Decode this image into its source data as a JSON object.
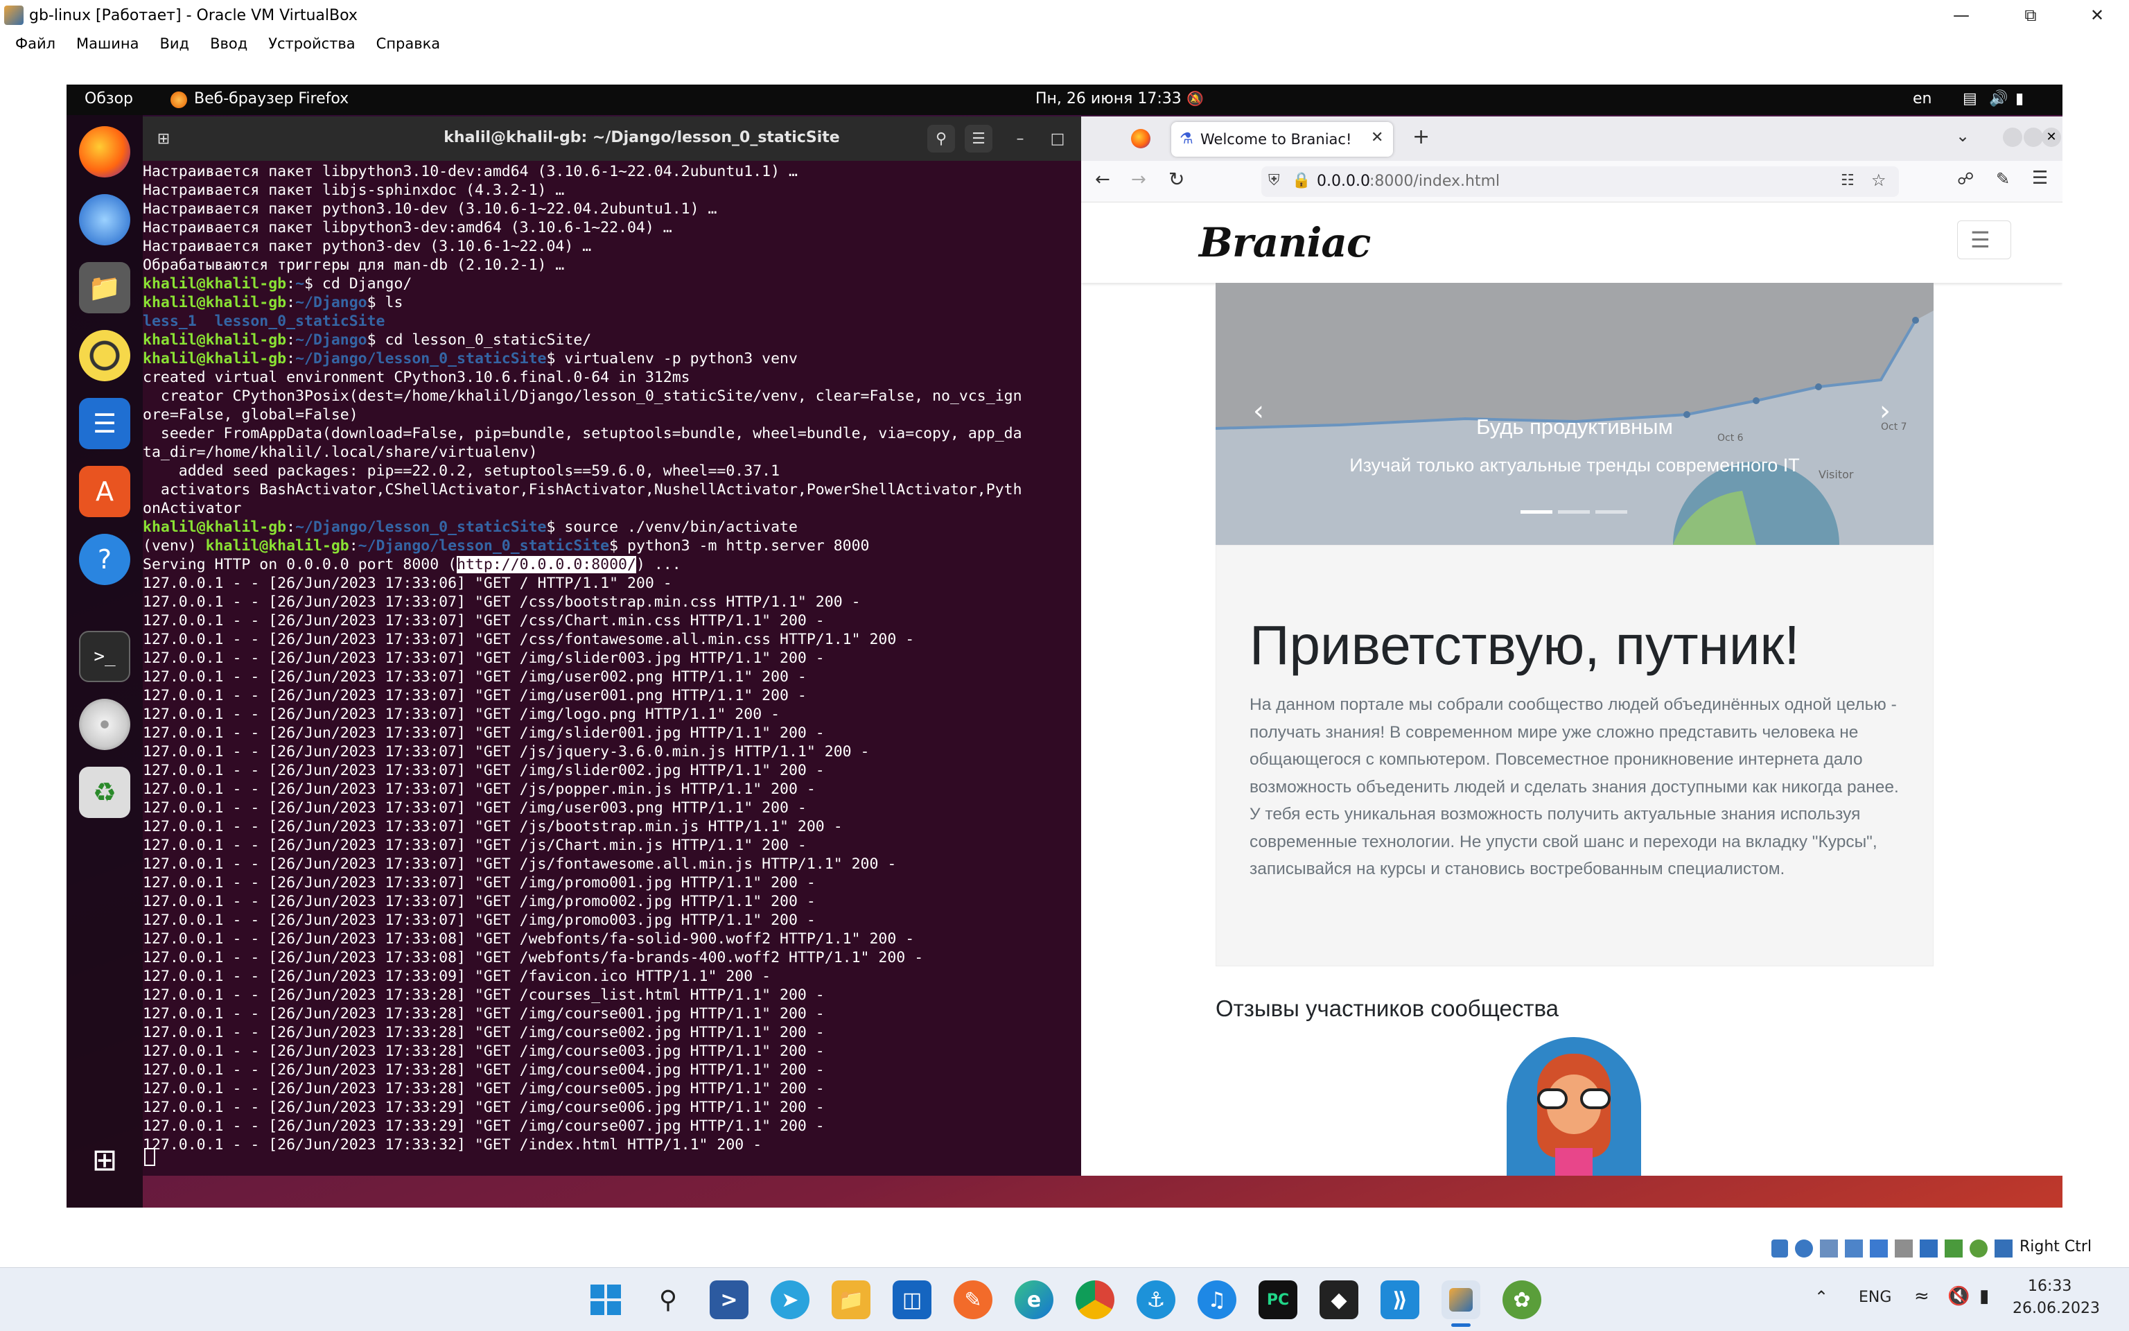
{
  "vbox": {
    "title": "gb-linux [Работает] - Oracle VM VirtualBox",
    "menu": [
      "Файл",
      "Машина",
      "Вид",
      "Ввод",
      "Устройства",
      "Справка"
    ],
    "host_key": "Right Ctrl"
  },
  "gnome": {
    "activities": "Обзор",
    "app_name": "Веб-браузер Firefox",
    "clock": "Пн, 26 июня  17:33",
    "lang": "en"
  },
  "terminal": {
    "title": "khalil@khalil-gb: ~/Django/lesson_0_staticSite",
    "lines": [
      [
        {
          "t": "Настраивается пакет libpython3.10-dev:amd64 (3.10.6-1~22.04.2ubuntu1.1) …"
        }
      ],
      [
        {
          "t": "Настраивается пакет libjs-sphinxdoc (4.3.2-1) …"
        }
      ],
      [
        {
          "t": "Настраивается пакет python3.10-dev (3.10.6-1~22.04.2ubuntu1.1) …"
        }
      ],
      [
        {
          "t": "Настраивается пакет libpython3-dev:amd64 (3.10.6-1~22.04) …"
        }
      ],
      [
        {
          "t": "Настраивается пакет python3-dev (3.10.6-1~22.04) …"
        }
      ],
      [
        {
          "t": "Обрабатываются триггеры для man-db (2.10.2-1) …"
        }
      ],
      [
        {
          "t": "khalil@khalil-gb",
          "c": "g"
        },
        {
          "t": ":"
        },
        {
          "t": "~",
          "c": "b"
        },
        {
          "t": "$ cd Django/"
        }
      ],
      [
        {
          "t": "khalil@khalil-gb",
          "c": "g"
        },
        {
          "t": ":"
        },
        {
          "t": "~/Django",
          "c": "b"
        },
        {
          "t": "$ ls"
        }
      ],
      [
        {
          "t": "less_1  lesson_0_staticSite",
          "c": "b"
        }
      ],
      [
        {
          "t": "khalil@khalil-gb",
          "c": "g"
        },
        {
          "t": ":"
        },
        {
          "t": "~/Django",
          "c": "b"
        },
        {
          "t": "$ cd lesson_0_staticSite/"
        }
      ],
      [
        {
          "t": "khalil@khalil-gb",
          "c": "g"
        },
        {
          "t": ":"
        },
        {
          "t": "~/Django/lesson_0_staticSite",
          "c": "b"
        },
        {
          "t": "$ virtualenv -p python3 venv"
        }
      ],
      [
        {
          "t": "created virtual environment CPython3.10.6.final.0-64 in 312ms"
        }
      ],
      [
        {
          "t": "  creator CPython3Posix(dest=/home/khalil/Django/lesson_0_staticSite/venv, clear=False, no_vcs_ign"
        }
      ],
      [
        {
          "t": "ore=False, global=False)"
        }
      ],
      [
        {
          "t": "  seeder FromAppData(download=False, pip=bundle, setuptools=bundle, wheel=bundle, via=copy, app_da"
        }
      ],
      [
        {
          "t": "ta_dir=/home/khalil/.local/share/virtualenv)"
        }
      ],
      [
        {
          "t": "    added seed packages: pip==22.0.2, setuptools==59.6.0, wheel==0.37.1"
        }
      ],
      [
        {
          "t": "  activators BashActivator,CShellActivator,FishActivator,NushellActivator,PowerShellActivator,Pyth"
        }
      ],
      [
        {
          "t": "onActivator"
        }
      ],
      [
        {
          "t": "khalil@khalil-gb",
          "c": "g"
        },
        {
          "t": ":"
        },
        {
          "t": "~/Django/lesson_0_staticSite",
          "c": "b"
        },
        {
          "t": "$ source ./venv/bin/activate"
        }
      ],
      [
        {
          "t": "(venv) "
        },
        {
          "t": "khalil@khalil-gb",
          "c": "g"
        },
        {
          "t": ":"
        },
        {
          "t": "~/Django/lesson_0_staticSite",
          "c": "b"
        },
        {
          "t": "$ python3 -m http.server 8000"
        }
      ],
      [
        {
          "t": "Serving HTTP on 0.0.0.0 port 8000 ("
        },
        {
          "t": "http://0.0.0.0:8000/",
          "c": "hl"
        },
        {
          "t": ") ..."
        }
      ],
      [
        {
          "t": "127.0.0.1 - - [26/Jun/2023 17:33:06] \"GET / HTTP/1.1\" 200 -"
        }
      ],
      [
        {
          "t": "127.0.0.1 - - [26/Jun/2023 17:33:07] \"GET /css/bootstrap.min.css HTTP/1.1\" 200 -"
        }
      ],
      [
        {
          "t": "127.0.0.1 - - [26/Jun/2023 17:33:07] \"GET /css/Chart.min.css HTTP/1.1\" 200 -"
        }
      ],
      [
        {
          "t": "127.0.0.1 - - [26/Jun/2023 17:33:07] \"GET /css/fontawesome.all.min.css HTTP/1.1\" 200 -"
        }
      ],
      [
        {
          "t": "127.0.0.1 - - [26/Jun/2023 17:33:07] \"GET /img/slider003.jpg HTTP/1.1\" 200 -"
        }
      ],
      [
        {
          "t": "127.0.0.1 - - [26/Jun/2023 17:33:07] \"GET /img/user002.png HTTP/1.1\" 200 -"
        }
      ],
      [
        {
          "t": "127.0.0.1 - - [26/Jun/2023 17:33:07] \"GET /img/user001.png HTTP/1.1\" 200 -"
        }
      ],
      [
        {
          "t": "127.0.0.1 - - [26/Jun/2023 17:33:07] \"GET /img/logo.png HTTP/1.1\" 200 -"
        }
      ],
      [
        {
          "t": "127.0.0.1 - - [26/Jun/2023 17:33:07] \"GET /img/slider001.jpg HTTP/1.1\" 200 -"
        }
      ],
      [
        {
          "t": "127.0.0.1 - - [26/Jun/2023 17:33:07] \"GET /js/jquery-3.6.0.min.js HTTP/1.1\" 200 -"
        }
      ],
      [
        {
          "t": "127.0.0.1 - - [26/Jun/2023 17:33:07] \"GET /img/slider002.jpg HTTP/1.1\" 200 -"
        }
      ],
      [
        {
          "t": "127.0.0.1 - - [26/Jun/2023 17:33:07] \"GET /js/popper.min.js HTTP/1.1\" 200 -"
        }
      ],
      [
        {
          "t": "127.0.0.1 - - [26/Jun/2023 17:33:07] \"GET /img/user003.png HTTP/1.1\" 200 -"
        }
      ],
      [
        {
          "t": "127.0.0.1 - - [26/Jun/2023 17:33:07] \"GET /js/bootstrap.min.js HTTP/1.1\" 200 -"
        }
      ],
      [
        {
          "t": "127.0.0.1 - - [26/Jun/2023 17:33:07] \"GET /js/Chart.min.js HTTP/1.1\" 200 -"
        }
      ],
      [
        {
          "t": "127.0.0.1 - - [26/Jun/2023 17:33:07] \"GET /js/fontawesome.all.min.js HTTP/1.1\" 200 -"
        }
      ],
      [
        {
          "t": "127.0.0.1 - - [26/Jun/2023 17:33:07] \"GET /img/promo001.jpg HTTP/1.1\" 200 -"
        }
      ],
      [
        {
          "t": "127.0.0.1 - - [26/Jun/2023 17:33:07] \"GET /img/promo002.jpg HTTP/1.1\" 200 -"
        }
      ],
      [
        {
          "t": "127.0.0.1 - - [26/Jun/2023 17:33:07] \"GET /img/promo003.jpg HTTP/1.1\" 200 -"
        }
      ],
      [
        {
          "t": "127.0.0.1 - - [26/Jun/2023 17:33:08] \"GET /webfonts/fa-solid-900.woff2 HTTP/1.1\" 200 -"
        }
      ],
      [
        {
          "t": "127.0.0.1 - - [26/Jun/2023 17:33:08] \"GET /webfonts/fa-brands-400.woff2 HTTP/1.1\" 200 -"
        }
      ],
      [
        {
          "t": "127.0.0.1 - - [26/Jun/2023 17:33:09] \"GET /favicon.ico HTTP/1.1\" 200 -"
        }
      ],
      [
        {
          "t": "127.0.0.1 - - [26/Jun/2023 17:33:28] \"GET /courses_list.html HTTP/1.1\" 200 -"
        }
      ],
      [
        {
          "t": "127.0.0.1 - - [26/Jun/2023 17:33:28] \"GET /img/course001.jpg HTTP/1.1\" 200 -"
        }
      ],
      [
        {
          "t": "127.0.0.1 - - [26/Jun/2023 17:33:28] \"GET /img/course002.jpg HTTP/1.1\" 200 -"
        }
      ],
      [
        {
          "t": "127.0.0.1 - - [26/Jun/2023 17:33:28] \"GET /img/course003.jpg HTTP/1.1\" 200 -"
        }
      ],
      [
        {
          "t": "127.0.0.1 - - [26/Jun/2023 17:33:28] \"GET /img/course004.jpg HTTP/1.1\" 200 -"
        }
      ],
      [
        {
          "t": "127.0.0.1 - - [26/Jun/2023 17:33:28] \"GET /img/course005.jpg HTTP/1.1\" 200 -"
        }
      ],
      [
        {
          "t": "127.0.0.1 - - [26/Jun/2023 17:33:29] \"GET /img/course006.jpg HTTP/1.1\" 200 -"
        }
      ],
      [
        {
          "t": "127.0.0.1 - - [26/Jun/2023 17:33:29] \"GET /img/course007.jpg HTTP/1.1\" 200 -"
        }
      ],
      [
        {
          "t": "127.0.0.1 - - [26/Jun/2023 17:33:32] \"GET /index.html HTTP/1.1\" 200 -"
        }
      ]
    ]
  },
  "firefox": {
    "tab_title": "Welcome to Braniac!",
    "url_host": "0.0.0.0",
    "url_rest": ":8000/index.html"
  },
  "site": {
    "logo": "Braniac",
    "slide_title": "Будь продуктивным",
    "slide_text": "Изучай только актуальные тренды современного IT",
    "chart_labels": [
      "Oct 6",
      "Oct 7",
      "Visitor"
    ],
    "jumbo_title": "Приветствую, путник!",
    "jumbo_text": "На данном портале мы собрали сообщество людей объединённых одной целью - получать знания! В современном мире уже сложно представить человека не общающегося с компьютером. Повсеместное проникновение интернета дало возможность объеденить людей и сделать знания доступными как никогда ранее. У тебя есть уникальная возможность получить актуальные знания используя современные технологии. Не упусти свой шанс и переходи на вкладку \"Курсы\", записывайся на курсы и становись востребованным специалистом.",
    "reviews_title": "Отзывы участников сообщества"
  },
  "taskbar": {
    "lang": "ENG",
    "time": "16:33",
    "date": "26.06.2023"
  }
}
